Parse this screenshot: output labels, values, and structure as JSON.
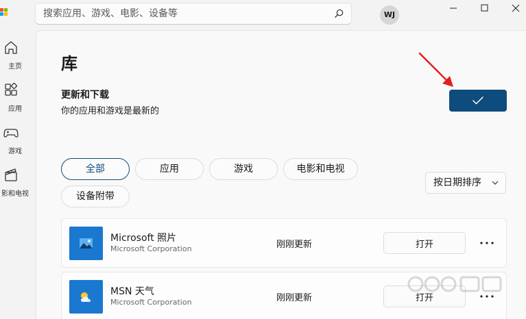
{
  "search": {
    "placeholder": "搜索应用、游戏、电影、设备等"
  },
  "user": {
    "initials": "WJ"
  },
  "nav": {
    "items": [
      {
        "label": "主页",
        "icon": "home-icon"
      },
      {
        "label": "应用",
        "icon": "apps-icon"
      },
      {
        "label": "游戏",
        "icon": "gamepad-icon"
      },
      {
        "label": "影和电视",
        "icon": "film-icon"
      }
    ]
  },
  "library": {
    "title": "库",
    "updates_title": "更新和下载",
    "updates_status": "你的应用和游戏是最新的"
  },
  "filters": {
    "tabs": [
      {
        "label": "全部",
        "active": true
      },
      {
        "label": "应用",
        "active": false
      },
      {
        "label": "游戏",
        "active": false
      },
      {
        "label": "电影和电视",
        "active": false
      },
      {
        "label": "设备附带",
        "active": false
      }
    ],
    "sort_label": "按日期排序"
  },
  "apps": [
    {
      "name": "Microsoft 照片",
      "publisher": "Microsoft Corporation",
      "status": "刚刚更新",
      "action": "打开",
      "icon": "photos-icon"
    },
    {
      "name": "MSN 天气",
      "publisher": "Microsoft Corporation",
      "status": "刚刚更新",
      "action": "打开",
      "icon": "weather-icon"
    }
  ],
  "colors": {
    "accent": "#0e4c7e",
    "app_tile": "#1b78d0",
    "arrow": "#e02020"
  }
}
